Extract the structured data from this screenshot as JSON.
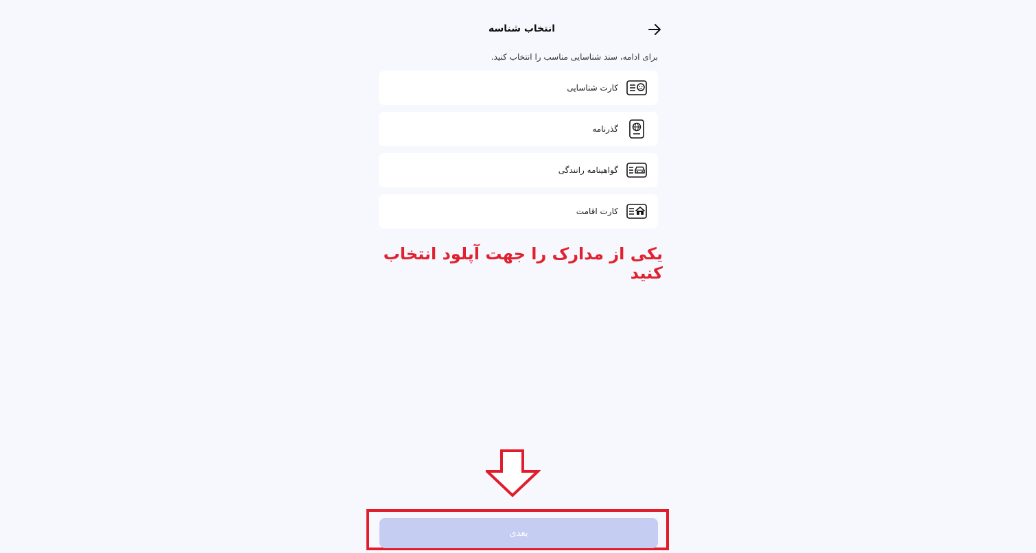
{
  "header": {
    "title": "انتخاب شناسه",
    "back_icon": "arrow-right-icon"
  },
  "subtitle": "برای ادامه، سند شناسایی مناسب را انتخاب کنید.",
  "options": [
    {
      "label": "کارت شناسایی",
      "icon": "id-card-icon"
    },
    {
      "label": "گذرنامه",
      "icon": "passport-icon"
    },
    {
      "label": "گواهینامه رانندگی",
      "icon": "driving-license-icon"
    },
    {
      "label": "کارت اقامت",
      "icon": "residence-card-icon"
    }
  ],
  "annotation": "یکی از مدارک را جهت آپلود انتخاب کنید",
  "next_button": {
    "label": "بعدی"
  },
  "colors": {
    "background": "#f7f8fd",
    "card": "#ffffff",
    "annotation_red": "#e0212f",
    "button_disabled": "#c5cdf3"
  }
}
